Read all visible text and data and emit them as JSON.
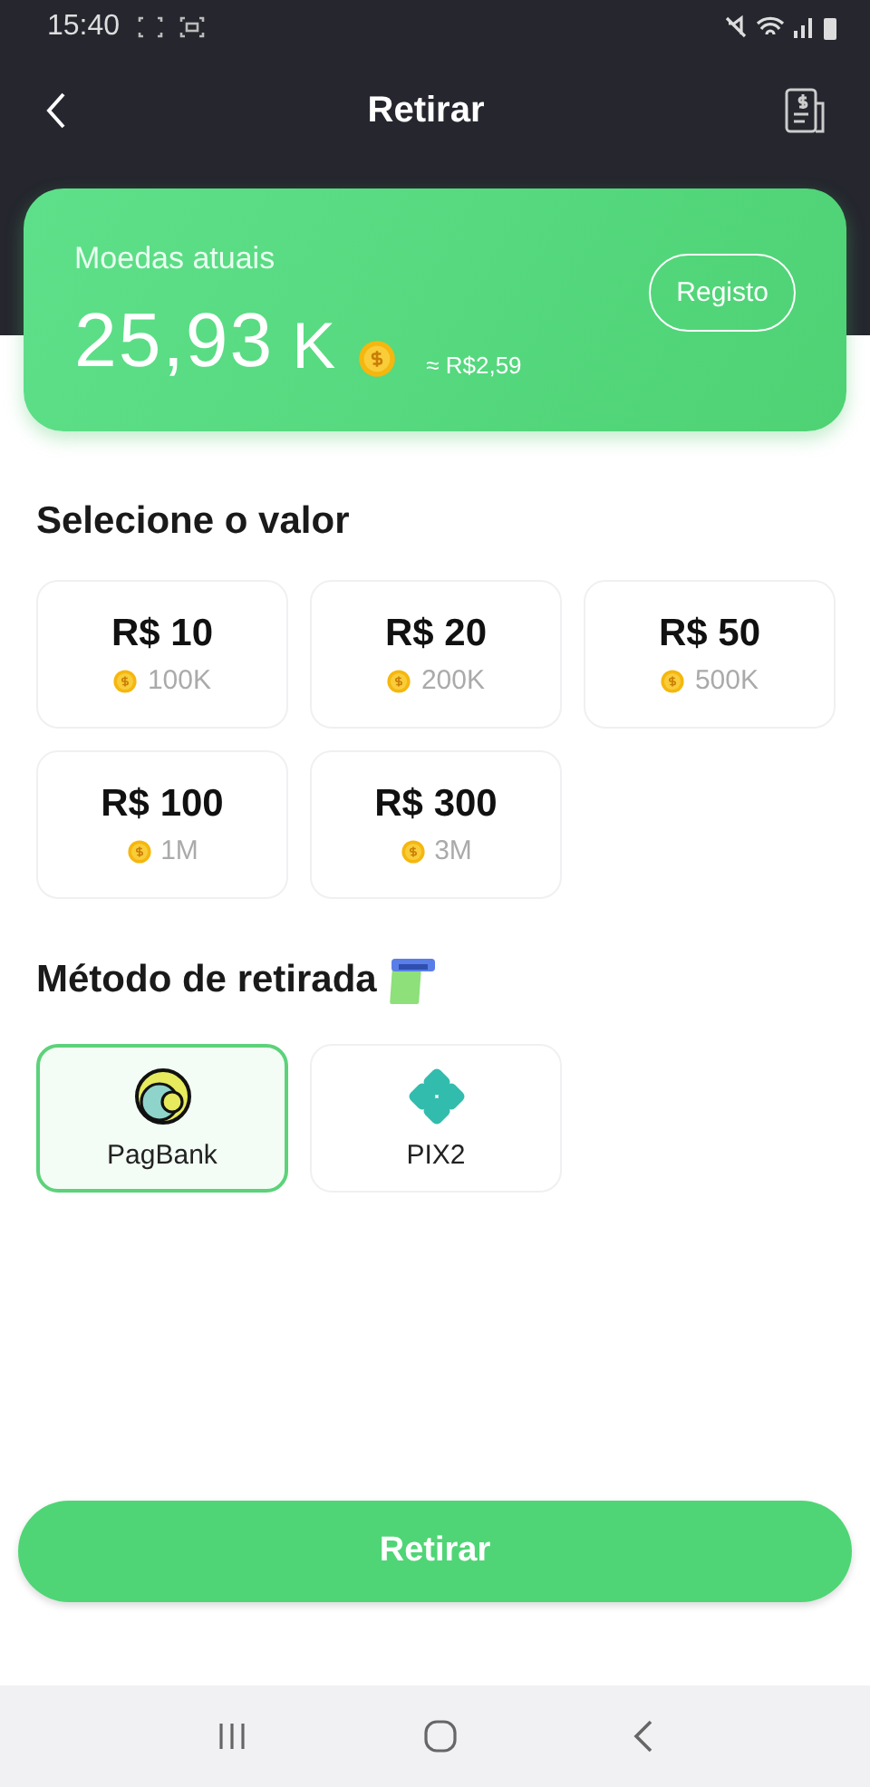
{
  "status_bar": {
    "time": "15:40"
  },
  "header": {
    "title": "Retirar"
  },
  "balance_card": {
    "label": "Moedas atuais",
    "amount": "25,93",
    "unit": "K",
    "approx": "≈ R$2,59",
    "history_button": "Registo"
  },
  "amount_section": {
    "title": "Selecione o valor",
    "options": [
      {
        "value": "R$ 10",
        "coins": "100K",
        "selected": false
      },
      {
        "value": "R$ 20",
        "coins": "200K",
        "selected": false
      },
      {
        "value": "R$ 50",
        "coins": "500K",
        "selected": false
      },
      {
        "value": "R$ 100",
        "coins": "1M",
        "selected": false
      },
      {
        "value": "R$ 300",
        "coins": "3M",
        "selected": false
      }
    ]
  },
  "method_section": {
    "title": "Método de retirada",
    "methods": [
      {
        "name": "PagBank",
        "kind": "pagbank",
        "selected": true
      },
      {
        "name": "PIX2",
        "kind": "pix",
        "selected": false
      }
    ]
  },
  "withdraw_button": "Retirar"
}
